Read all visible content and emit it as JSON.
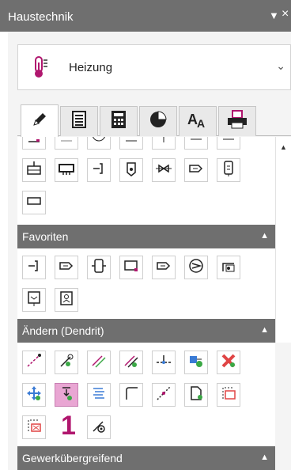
{
  "window": {
    "title": "Haustechnik",
    "pin_glyph": "▼",
    "close_glyph": "×"
  },
  "dropdown": {
    "icon": "thermometer-icon",
    "selected": "Heizung",
    "chevron": "⌄"
  },
  "tabs": [
    {
      "icon": "pencil-icon",
      "active": true
    },
    {
      "icon": "list-icon",
      "active": false
    },
    {
      "icon": "calculator-icon",
      "active": false
    },
    {
      "icon": "pie-chart-icon",
      "active": false
    },
    {
      "icon": "text-style-icon",
      "active": false
    },
    {
      "icon": "printer-icon",
      "active": false
    }
  ],
  "scroll_up_glyph": "▲",
  "sections": {
    "favoriten": {
      "label": "Favoriten",
      "caret": "▲"
    },
    "aendern": {
      "label": "Ändern (Dendrit)",
      "caret": "▲"
    },
    "gewerk": {
      "label": "Gewerkübergreifend",
      "caret": "▲"
    }
  },
  "aendern_big_label": "1",
  "colors": {
    "header": "#6f6f6f",
    "selected": "#e9a6d3",
    "accent_magenta": "#b0166e",
    "green": "#3aa845",
    "red": "#e04444"
  }
}
